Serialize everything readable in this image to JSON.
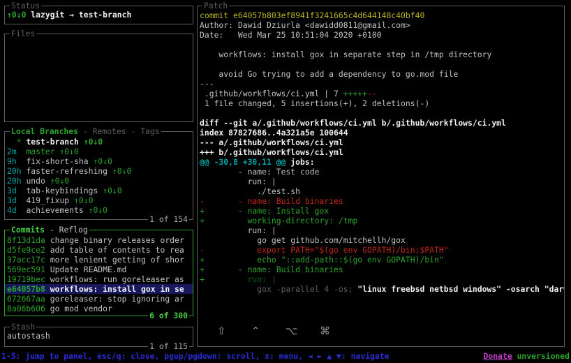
{
  "palette": {
    "bg": "#000000",
    "border": "#5f5f5f",
    "fg": "#c2c2c2",
    "white": "#efefef",
    "green": "#2ba32b",
    "greenB": "#49cf49",
    "greenDim": "#0f5f0f",
    "cyan": "#00a3a3",
    "yellow": "#b8b426",
    "red": "#c02717",
    "blue": "#2b2bd4",
    "magenta": "#c341c3",
    "gray": "#5f5f5f",
    "counter": "#ababab",
    "selBg": "#17175e"
  },
  "status": {
    "title": "Status",
    "line": [
      {
        "t": "↑0↓0 ",
        "c": "green",
        "b": 1
      },
      {
        "t": "lazygit → test-branch",
        "c": "white",
        "b": 1
      }
    ]
  },
  "files": {
    "title": "Files"
  },
  "branches": {
    "title": [
      {
        "t": "Local Branches",
        "c": "green",
        "b": 1,
        "n": "tab-local-branches",
        "i": true
      },
      {
        "t": " - ",
        "c": "gray"
      },
      {
        "t": "Remotes",
        "c": "gray",
        "n": "tab-remotes",
        "i": true
      },
      {
        "t": " - ",
        "c": "gray"
      },
      {
        "t": "Tags",
        "c": "gray",
        "n": "tab-tags",
        "i": true
      }
    ],
    "counter": "1 of 154",
    "rows": [
      {
        "segs": [
          {
            "t": "  ",
            "c": "fg"
          },
          {
            "t": "*",
            "c": "green"
          },
          {
            "t": " ",
            "c": "fg"
          },
          {
            "t": "test-branch",
            "c": "white",
            "b": 1
          },
          {
            "t": " ",
            "c": "fg"
          },
          {
            "t": "↑0↓0",
            "c": "green",
            "b": 1
          }
        ]
      },
      {
        "segs": [
          {
            "t": "2m  ",
            "c": "cyan"
          },
          {
            "t": "master",
            "c": "green"
          },
          {
            "t": " ",
            "c": "fg"
          },
          {
            "t": "↑0↓0",
            "c": "green"
          }
        ]
      },
      {
        "segs": [
          {
            "t": "9h  ",
            "c": "cyan"
          },
          {
            "t": "fix-short-sha",
            "c": "fg"
          },
          {
            "t": " ",
            "c": "fg"
          },
          {
            "t": "↑0↓0",
            "c": "green"
          }
        ]
      },
      {
        "segs": [
          {
            "t": "20h ",
            "c": "cyan"
          },
          {
            "t": "faster-refreshing",
            "c": "fg"
          },
          {
            "t": " ",
            "c": "fg"
          },
          {
            "t": "↑0↓0",
            "c": "green"
          }
        ]
      },
      {
        "segs": [
          {
            "t": "20h ",
            "c": "cyan"
          },
          {
            "t": "undo",
            "c": "fg"
          },
          {
            "t": " ",
            "c": "fg"
          },
          {
            "t": "↑0↓0",
            "c": "green"
          }
        ]
      },
      {
        "segs": [
          {
            "t": "3d  ",
            "c": "cyan"
          },
          {
            "t": "tab-keybindings",
            "c": "fg"
          },
          {
            "t": " ",
            "c": "fg"
          },
          {
            "t": "↑0↓0",
            "c": "green"
          }
        ]
      },
      {
        "segs": [
          {
            "t": "3d  ",
            "c": "cyan"
          },
          {
            "t": "419_fixup",
            "c": "fg"
          },
          {
            "t": " ",
            "c": "fg"
          },
          {
            "t": "↑0↓0",
            "c": "green"
          }
        ]
      },
      {
        "segs": [
          {
            "t": "4d  ",
            "c": "cyan"
          },
          {
            "t": "achievements",
            "c": "fg"
          },
          {
            "t": " ",
            "c": "fg"
          },
          {
            "t": "↑0↓0",
            "c": "green"
          }
        ]
      }
    ]
  },
  "commits": {
    "title": [
      {
        "t": "Commits",
        "c": "greenB",
        "b": 1,
        "n": "tab-commits",
        "i": true
      },
      {
        "t": " - ",
        "c": "fg"
      },
      {
        "t": "Reflog",
        "c": "fg",
        "n": "tab-reflog",
        "i": true
      }
    ],
    "counter": "6 of 300",
    "rows": [
      {
        "segs": [
          {
            "t": "8f13d1da",
            "c": "green"
          },
          {
            "t": " change binary releases order",
            "c": "fg"
          }
        ]
      },
      {
        "segs": [
          {
            "t": "d5fe9ce2",
            "c": "green"
          },
          {
            "t": " add table of contents to rea",
            "c": "fg"
          }
        ]
      },
      {
        "segs": [
          {
            "t": "37acc17c",
            "c": "green"
          },
          {
            "t": " more lenient getting of shor",
            "c": "fg"
          }
        ]
      },
      {
        "segs": [
          {
            "t": "569ec591",
            "c": "green"
          },
          {
            "t": " Update README.md",
            "c": "fg"
          }
        ]
      },
      {
        "segs": [
          {
            "t": "19719bec",
            "c": "green"
          },
          {
            "t": " workflows: run goreleaser as",
            "c": "fg"
          }
        ]
      },
      {
        "selected": true,
        "segs": [
          {
            "t": "e64057b8",
            "c": "green",
            "b": 1
          },
          {
            "t": " workflows: install gox in se",
            "c": "white",
            "b": 1
          }
        ]
      },
      {
        "segs": [
          {
            "t": "672667aa",
            "c": "green"
          },
          {
            "t": " goreleaser: stop ignoring ar",
            "c": "fg"
          }
        ]
      },
      {
        "segs": [
          {
            "t": "8a06b606",
            "c": "green"
          },
          {
            "t": " go mod vendor",
            "c": "fg"
          }
        ]
      }
    ]
  },
  "stash": {
    "title": "Stash",
    "counter": "1 of 115",
    "rows": [
      {
        "segs": [
          {
            "t": "autostash",
            "c": "fg"
          }
        ]
      }
    ]
  },
  "patch": {
    "title": "Patch",
    "lines": [
      {
        "segs": [
          {
            "t": "commit e64057b803ef8941f3241665c4d644148c40bf40",
            "c": "yellow"
          }
        ]
      },
      {
        "segs": [
          {
            "t": "Author: Dawid Dziurla <dawidd0811@gmail.com>",
            "c": "fg"
          }
        ]
      },
      {
        "segs": [
          {
            "t": "Date:   Wed Mar 25 10:51:04 2020 +0100",
            "c": "fg"
          }
        ]
      },
      {
        "segs": []
      },
      {
        "segs": [
          {
            "t": "    workflows: install gox in separate step in /tmp directory",
            "c": "fg"
          }
        ]
      },
      {
        "segs": []
      },
      {
        "segs": [
          {
            "t": "    avoid Go trying to add a dependency to go.mod file",
            "c": "fg"
          }
        ]
      },
      {
        "segs": [
          {
            "t": "---",
            "c": "fg"
          }
        ]
      },
      {
        "segs": [
          {
            "t": " .github/workflows/ci.yml | 7 ",
            "c": "fg"
          },
          {
            "t": "+++++",
            "c": "green"
          },
          {
            "t": "--",
            "c": "red"
          }
        ]
      },
      {
        "segs": [
          {
            "t": " 1 file changed, 5 insertions(+), 2 deletions(-)",
            "c": "fg"
          }
        ]
      },
      {
        "segs": []
      },
      {
        "segs": [
          {
            "t": "diff --git a/.github/workflows/ci.yml b/.github/workflows/ci.yml",
            "c": "white",
            "b": 1
          }
        ]
      },
      {
        "segs": [
          {
            "t": "index 87827686..4a321a5e 100644",
            "c": "white",
            "b": 1
          }
        ]
      },
      {
        "segs": [
          {
            "t": "--- a/.github/workflows/ci.yml",
            "c": "white",
            "b": 1
          }
        ]
      },
      {
        "segs": [
          {
            "t": "+++ b/.github/workflows/ci.yml",
            "c": "white",
            "b": 1
          }
        ]
      },
      {
        "segs": [
          {
            "t": "@@ -30,8 +30,11 @@",
            "c": "cyan",
            "b": 1
          },
          {
            "t": " jobs:",
            "c": "white",
            "b": 1
          }
        ]
      },
      {
        "segs": [
          {
            "t": "        - name: Test code",
            "c": "fg"
          }
        ]
      },
      {
        "segs": [
          {
            "t": "          run: |",
            "c": "fg"
          }
        ]
      },
      {
        "segs": [
          {
            "t": "            ./test.sh",
            "c": "fg"
          }
        ]
      },
      {
        "segs": [
          {
            "t": "-       - name: Build binaries",
            "c": "red"
          }
        ]
      },
      {
        "segs": [
          {
            "t": "+       - name: Install gox",
            "c": "green"
          }
        ]
      },
      {
        "segs": [
          {
            "t": "+         working-directory: /tmp",
            "c": "green"
          }
        ]
      },
      {
        "segs": [
          {
            "t": "          run: |",
            "c": "fg"
          }
        ]
      },
      {
        "segs": [
          {
            "t": "            go get github.com/mitchellh/gox",
            "c": "fg"
          }
        ]
      },
      {
        "segs": [
          {
            "t": "-           export PATH=\"$(go env GOPATH)/bin:$PATH\"",
            "c": "red"
          }
        ]
      },
      {
        "segs": [
          {
            "t": "+           echo \"::add-path::$(go env GOPATH)/bin\"",
            "c": "green"
          }
        ]
      },
      {
        "segs": [
          {
            "t": "+       - name: Build binaries",
            "c": "green"
          }
        ]
      },
      {
        "segs": [
          {
            "t": "+",
            "c": "green"
          },
          {
            "t": "         run: |",
            "c": "greenDim"
          }
        ]
      },
      {
        "segs": [
          {
            "t": "            gox -parallel 4 -os;",
            "c": "gray"
          },
          {
            "t": " \"linux freebsd netbsd windows\" -osarch \"darw",
            "c": "white",
            "b": 1
          }
        ]
      }
    ],
    "modifier_keys": [
      {
        "symbol": "⇧",
        "name": "shift-icon"
      },
      {
        "symbol": "⌃",
        "name": "control-icon"
      },
      {
        "symbol": "⌥",
        "name": "option-icon"
      },
      {
        "symbol": "⌘",
        "name": "command-icon"
      }
    ]
  },
  "statusbar": {
    "left": [
      {
        "t": "1-5: jump to panel, esc/q: close, pgup/pgdown: scroll, x: menu, ◄ ► ▲ ▼: navigate",
        "c": "blue",
        "b": 1
      }
    ],
    "right": [
      {
        "t": "Donate",
        "c": "magenta",
        "u": 1,
        "b": 1,
        "n": "donate-link",
        "i": true
      },
      {
        "t": " ",
        "c": "fg"
      },
      {
        "t": "unversioned",
        "c": "green",
        "b": 1,
        "n": "version-label"
      }
    ]
  }
}
